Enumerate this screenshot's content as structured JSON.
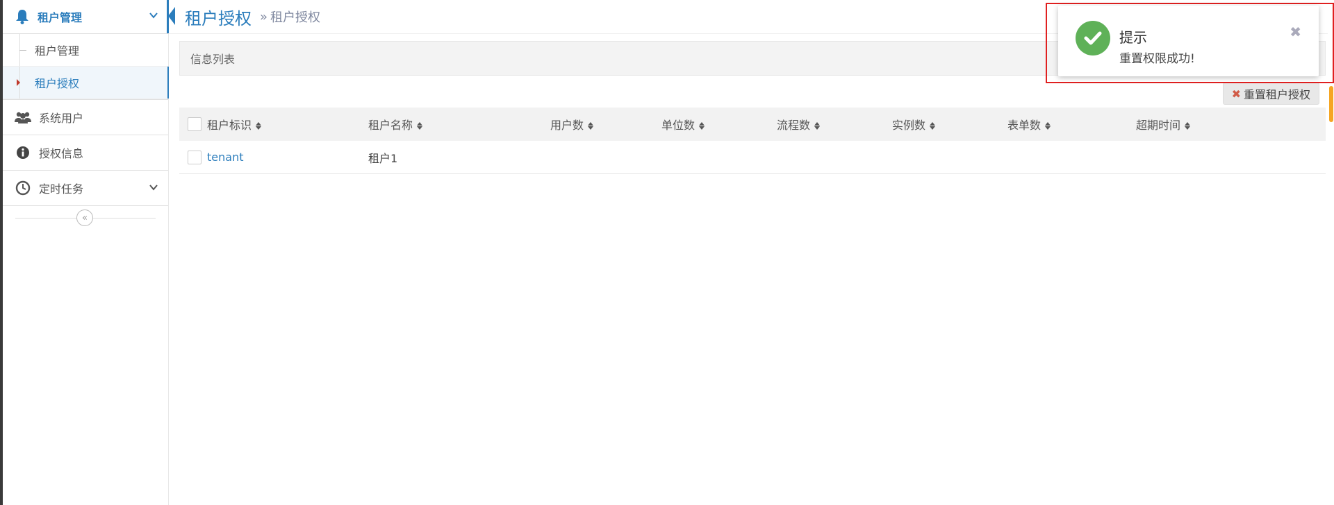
{
  "sidebar": {
    "group": {
      "label": "租户管理",
      "icon": "bell-icon"
    },
    "sub_items": [
      {
        "label": "租户管理",
        "active": false
      },
      {
        "label": "租户授权",
        "active": true
      }
    ],
    "items": [
      {
        "label": "系统用户",
        "icon": "users-icon"
      },
      {
        "label": "授权信息",
        "icon": "info-circle-icon"
      },
      {
        "label": "定时任务",
        "icon": "clock-icon"
      }
    ],
    "collapse_icon": "double-chevron-left-icon"
  },
  "breadcrumb": {
    "title": "租户授权",
    "separator": "»",
    "current": "租户授权"
  },
  "panel": {
    "title": "信息列表",
    "reset_button_label": "重置租户授权",
    "reset_icon": "x-icon"
  },
  "table": {
    "columns": [
      "租户标识",
      "租户名称",
      "用户数",
      "单位数",
      "流程数",
      "实例数",
      "表单数",
      "超期时间"
    ],
    "rows": [
      {
        "tenant_id": "tenant",
        "tenant_name": "租户1",
        "users": "",
        "units": "",
        "flows": "",
        "instances": "",
        "forms": "",
        "expire": ""
      }
    ]
  },
  "toast": {
    "title": "提示",
    "message": "重置权限成功!",
    "icon": "check-circle-icon",
    "close_icon": "close-icon"
  },
  "colors": {
    "accent": "#2b7dbc",
    "success": "#5fb158",
    "highlight": "#e02020"
  }
}
